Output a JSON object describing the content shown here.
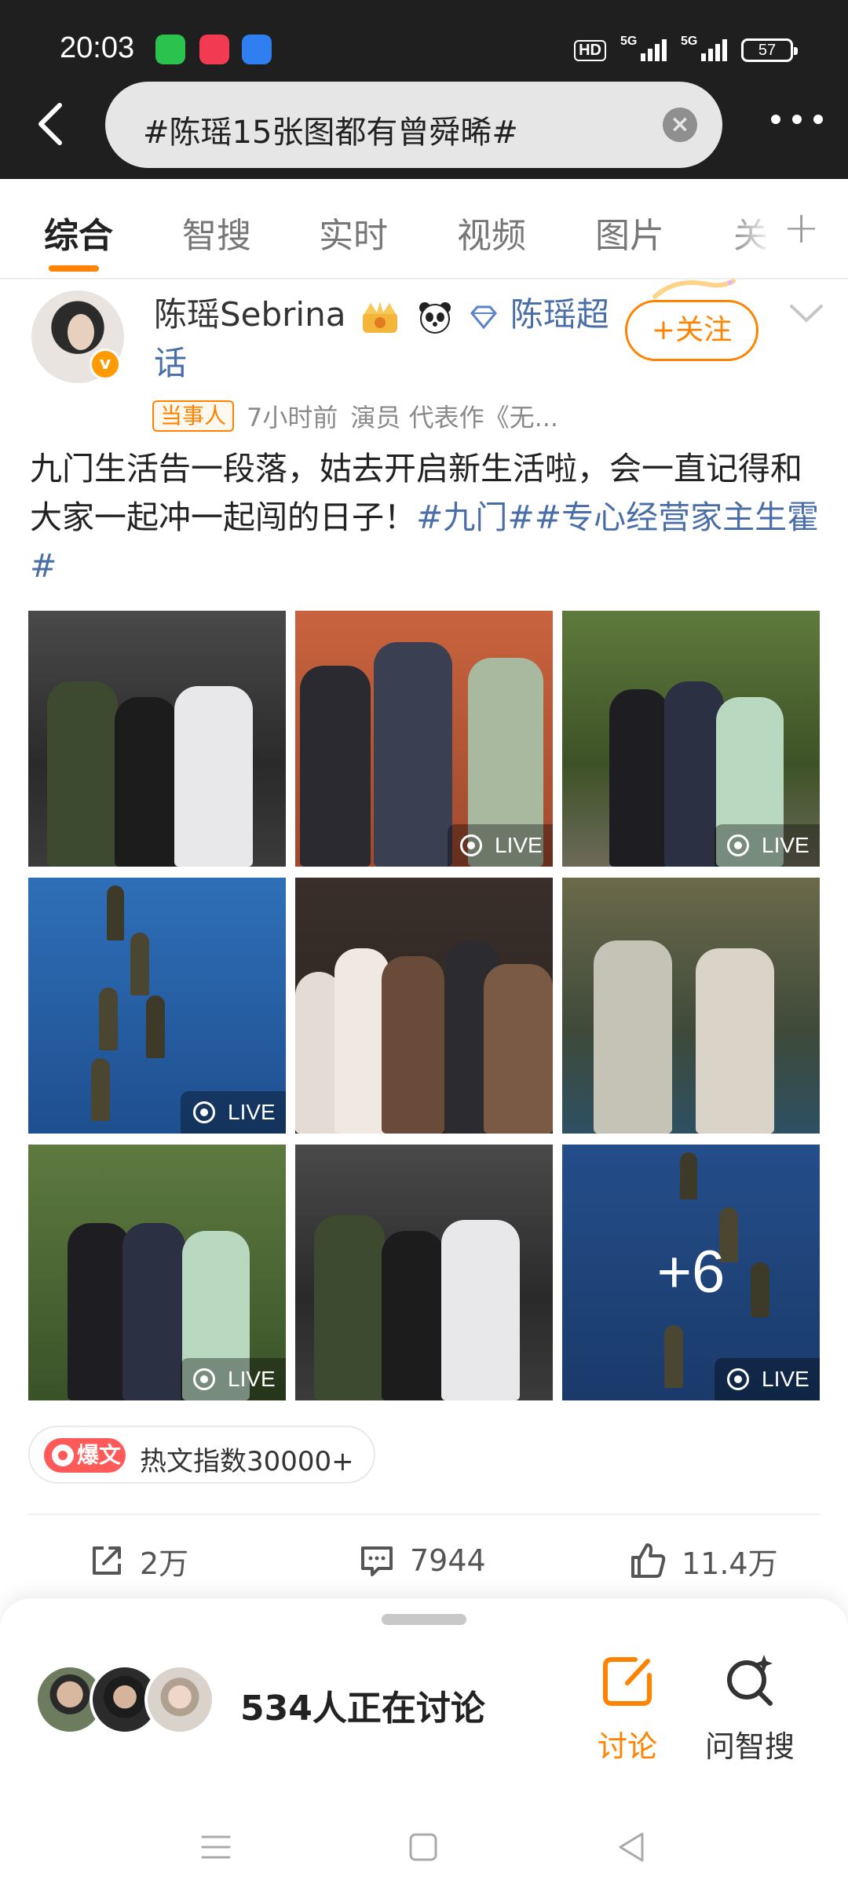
{
  "status_bar": {
    "time": "20:03",
    "hd_label": "HD",
    "signal1_label": "5G",
    "signal2_label": "5G",
    "battery": "57"
  },
  "search": {
    "query": "#陈瑶15张图都有曾舜晞#"
  },
  "tabs": [
    {
      "label": "综合",
      "active": true
    },
    {
      "label": "智搜"
    },
    {
      "label": "实时"
    },
    {
      "label": "视频"
    },
    {
      "label": "图片"
    },
    {
      "label": "关"
    }
  ],
  "post": {
    "author": "陈瑶Sebrina",
    "supertopic": "陈瑶超话",
    "follow_label": "+关注",
    "badge": "当事人",
    "time": "7小时前",
    "role": "演员 代表作《无...",
    "text": "九门生活告一段落，姑去开启新生活啦，会一直记得和大家一起冲一起闯的日子！",
    "hashtags": [
      "#九门#",
      "#专心经营家主生霍#"
    ],
    "live_label": "LIVE",
    "more_photos": "+6",
    "hot_tag": "爆文",
    "hot_text": "热文指数30000+",
    "reposts": "2万",
    "comments": "7944",
    "likes": "11.4万"
  },
  "sheet": {
    "discussing": "534人正在讨论",
    "discuss_label": "讨论",
    "zhisou_label": "问智搜"
  },
  "colors": {
    "accent": "#ff8200",
    "link": "#4a6ea8",
    "header_bg": "#1f1f1f"
  }
}
